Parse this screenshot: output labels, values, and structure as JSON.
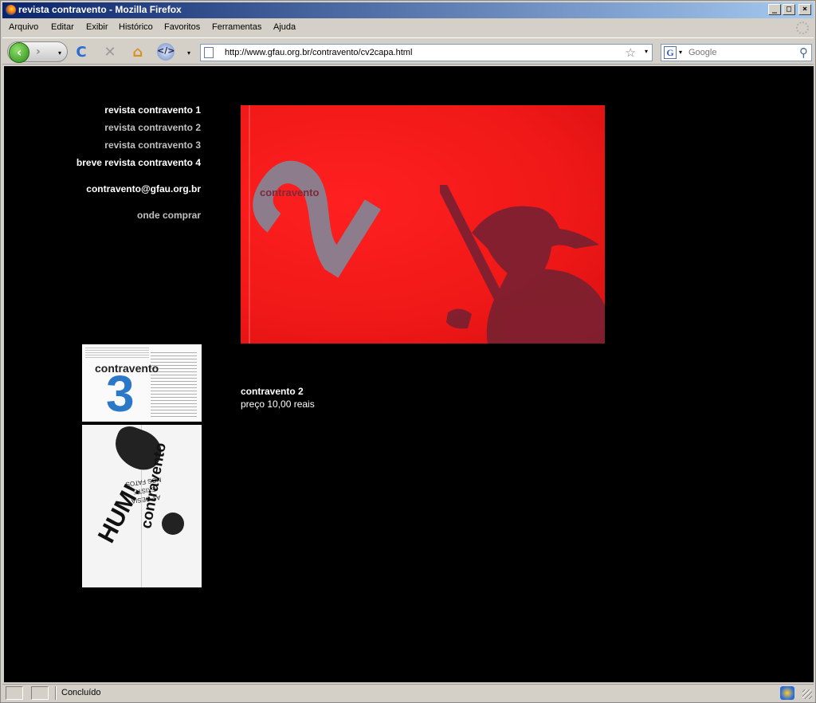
{
  "window": {
    "title": "revista contravento - Mozilla Firefox",
    "buttons": [
      "_",
      "□",
      "×"
    ]
  },
  "menubar": {
    "items": [
      "Arquivo",
      "Editar",
      "Exibir",
      "Histórico",
      "Favoritos",
      "Ferramentas",
      "Ajuda"
    ]
  },
  "toolbar": {
    "url": "http://www.gfau.org.br/contravento/cv2capa.html",
    "search_placeholder": "Google",
    "back_glyph": "‹",
    "forward_glyph": "›",
    "reload_glyph": "C",
    "stop_glyph": "✕",
    "home_glyph": "⌂",
    "dropdown_glyph": "▾",
    "star_glyph": "☆",
    "magnifier_glyph": "⚲",
    "google_glyph": "G"
  },
  "page": {
    "nav_links": [
      {
        "label": "revista contravento 1",
        "color": "#ffffff"
      },
      {
        "label": "revista contravento 2",
        "color": "#c0c0c0"
      },
      {
        "label": "revista contravento 3",
        "color": "#c0c0c0"
      },
      {
        "label": "breve revista contravento 4",
        "color": "#ffffff"
      },
      {
        "label": "contravento@gfau.org.br",
        "color": "#ffffff"
      },
      {
        "label": "onde comprar",
        "color": "#c0c0c0"
      }
    ],
    "cover": {
      "title": "contravento",
      "number": "2",
      "background": "#f01818"
    },
    "info": {
      "title": "contravento 2",
      "price": "preço 10,00 reais"
    },
    "thumbnails": [
      {
        "title": "contravento",
        "number": "3",
        "accent": "#2c78c8"
      },
      {
        "title": "contravento",
        "headline": "HUM!",
        "poem_lines": [
          "A POESIA",
          "EXISTE",
          "NOS FATOS"
        ]
      }
    ]
  },
  "statusbar": {
    "text": "Concluído"
  },
  "colors": {
    "chrome": "#d4d0c8",
    "titlebar_start": "#0a246a",
    "titlebar_end": "#a6caf0",
    "page_bg": "#000000"
  }
}
